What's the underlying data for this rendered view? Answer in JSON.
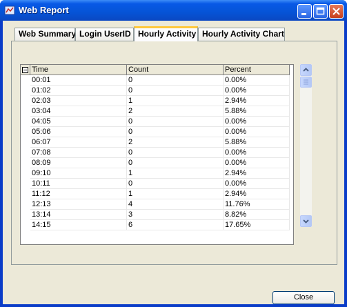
{
  "window": {
    "title": "Web Report"
  },
  "tabs": [
    {
      "label": "Web Summary"
    },
    {
      "label": "Login UserID"
    },
    {
      "label": "Hourly Activity"
    },
    {
      "label": "Hourly Activity  Chart"
    }
  ],
  "table": {
    "headers": [
      "Time",
      "Count",
      "Percent"
    ],
    "rows": [
      [
        "00:01",
        "0",
        "0.00%"
      ],
      [
        "01:02",
        "0",
        "0.00%"
      ],
      [
        "02:03",
        "1",
        "2.94%"
      ],
      [
        "03:04",
        "2",
        "5.88%"
      ],
      [
        "04:05",
        "0",
        "0.00%"
      ],
      [
        "05:06",
        "0",
        "0.00%"
      ],
      [
        "06:07",
        "2",
        "5.88%"
      ],
      [
        "07:08",
        "0",
        "0.00%"
      ],
      [
        "08:09",
        "0",
        "0.00%"
      ],
      [
        "09:10",
        "1",
        "2.94%"
      ],
      [
        "10:11",
        "0",
        "0.00%"
      ],
      [
        "11:12",
        "1",
        "2.94%"
      ],
      [
        "12:13",
        "4",
        "11.76%"
      ],
      [
        "13:14",
        "3",
        "8.82%"
      ],
      [
        "14:15",
        "6",
        "17.65%"
      ]
    ]
  },
  "buttons": {
    "close": "Close"
  }
}
